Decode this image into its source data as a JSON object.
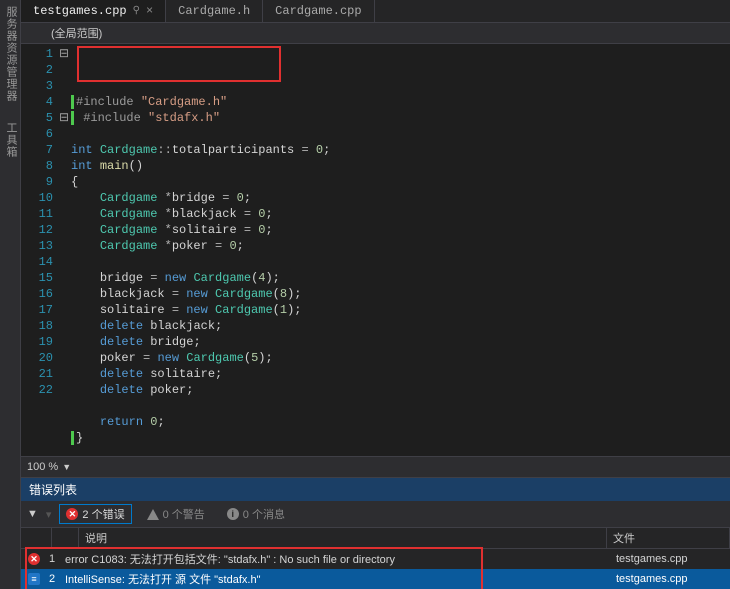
{
  "sidebar": {
    "tabs": [
      "服务器资源管理器",
      "工具箱"
    ]
  },
  "tabs": {
    "items": [
      {
        "label": "testgames.cpp",
        "active": true,
        "pinned": true
      },
      {
        "label": "Cardgame.h",
        "active": false,
        "pinned": false
      },
      {
        "label": "Cardgame.cpp",
        "active": false,
        "pinned": false
      }
    ]
  },
  "scope": {
    "label": "(全局范围)"
  },
  "zoom": {
    "value": "100 %"
  },
  "code": {
    "lines": [
      {
        "n": "1",
        "fold": "⊟",
        "html": "<span class='bar-green'></span><span class='pre'>#include</span> <span class='str'>\"Cardgame.h\"</span>"
      },
      {
        "n": "2",
        "fold": "",
        "html": "<span class='bar-green'></span>&nbsp;<span class='pre'>#include</span> <span class='str'>\"stdafx.h\"</span>"
      },
      {
        "n": "3",
        "fold": "",
        "html": ""
      },
      {
        "n": "4",
        "fold": "",
        "html": "<span class='kw'>int</span> <span class='type'>Cardgame</span><span class='op'>::</span><span class='id'>totalparticipants</span> <span class='op'>=</span> <span class='num'>0</span>;"
      },
      {
        "n": "5",
        "fold": "⊟",
        "html": "<span class='kw'>int</span> <span class='fn'>main</span>()"
      },
      {
        "n": "6",
        "fold": "",
        "html": "{"
      },
      {
        "n": "7",
        "fold": "",
        "html": "    <span class='type'>Cardgame</span> <span class='op'>*</span><span class='id'>bridge</span> <span class='op'>=</span> <span class='num'>0</span>;"
      },
      {
        "n": "8",
        "fold": "",
        "html": "    <span class='type'>Cardgame</span> <span class='op'>*</span><span class='id'>blackjack</span> <span class='op'>=</span> <span class='num'>0</span>;"
      },
      {
        "n": "9",
        "fold": "",
        "html": "    <span class='type'>Cardgame</span> <span class='op'>*</span><span class='id'>solitaire</span> <span class='op'>=</span> <span class='num'>0</span>;"
      },
      {
        "n": "10",
        "fold": "",
        "html": "    <span class='type'>Cardgame</span> <span class='op'>*</span><span class='id'>poker</span> <span class='op'>=</span> <span class='num'>0</span>;"
      },
      {
        "n": "11",
        "fold": "",
        "html": ""
      },
      {
        "n": "12",
        "fold": "",
        "html": "    <span class='id'>bridge</span> <span class='op'>=</span> <span class='kw'>new</span> <span class='type'>Cardgame</span>(<span class='num'>4</span>);"
      },
      {
        "n": "13",
        "fold": "",
        "html": "    <span class='id'>blackjack</span> <span class='op'>=</span> <span class='kw'>new</span> <span class='type'>Cardgame</span>(<span class='num'>8</span>);"
      },
      {
        "n": "14",
        "fold": "",
        "html": "    <span class='id'>solitaire</span> <span class='op'>=</span> <span class='kw'>new</span> <span class='type'>Cardgame</span>(<span class='num'>1</span>);"
      },
      {
        "n": "15",
        "fold": "",
        "html": "    <span class='kw'>delete</span> <span class='id'>blackjack</span>;"
      },
      {
        "n": "16",
        "fold": "",
        "html": "    <span class='kw'>delete</span> <span class='id'>bridge</span>;"
      },
      {
        "n": "17",
        "fold": "",
        "html": "    <span class='id'>poker</span> <span class='op'>=</span> <span class='kw'>new</span> <span class='type'>Cardgame</span>(<span class='num'>5</span>);"
      },
      {
        "n": "18",
        "fold": "",
        "html": "    <span class='kw'>delete</span> <span class='id'>solitaire</span>;"
      },
      {
        "n": "19",
        "fold": "",
        "html": "    <span class='kw'>delete</span> <span class='id'>poker</span>;"
      },
      {
        "n": "20",
        "fold": "",
        "html": ""
      },
      {
        "n": "21",
        "fold": "",
        "html": "    <span class='kw'>return</span> <span class='num'>0</span>;"
      },
      {
        "n": "22",
        "fold": "",
        "html": "<span class='bar-green'></span>}"
      }
    ]
  },
  "errors": {
    "panel_title": "错误列表",
    "filters": {
      "errors": "2 个错误",
      "warnings": "0 个警告",
      "messages": "0 个消息"
    },
    "columns": {
      "desc": "说明",
      "file": "文件"
    },
    "rows": [
      {
        "icon": "err",
        "num": "1",
        "desc": "error C1083: 无法打开包括文件:  \"stdafx.h\" : No such file or directory",
        "file": "testgames.cpp",
        "sel": false
      },
      {
        "icon": "intel",
        "num": "2",
        "desc": "IntelliSense:  无法打开 源 文件 \"stdafx.h\"",
        "file": "testgames.cpp",
        "sel": true
      }
    ]
  }
}
